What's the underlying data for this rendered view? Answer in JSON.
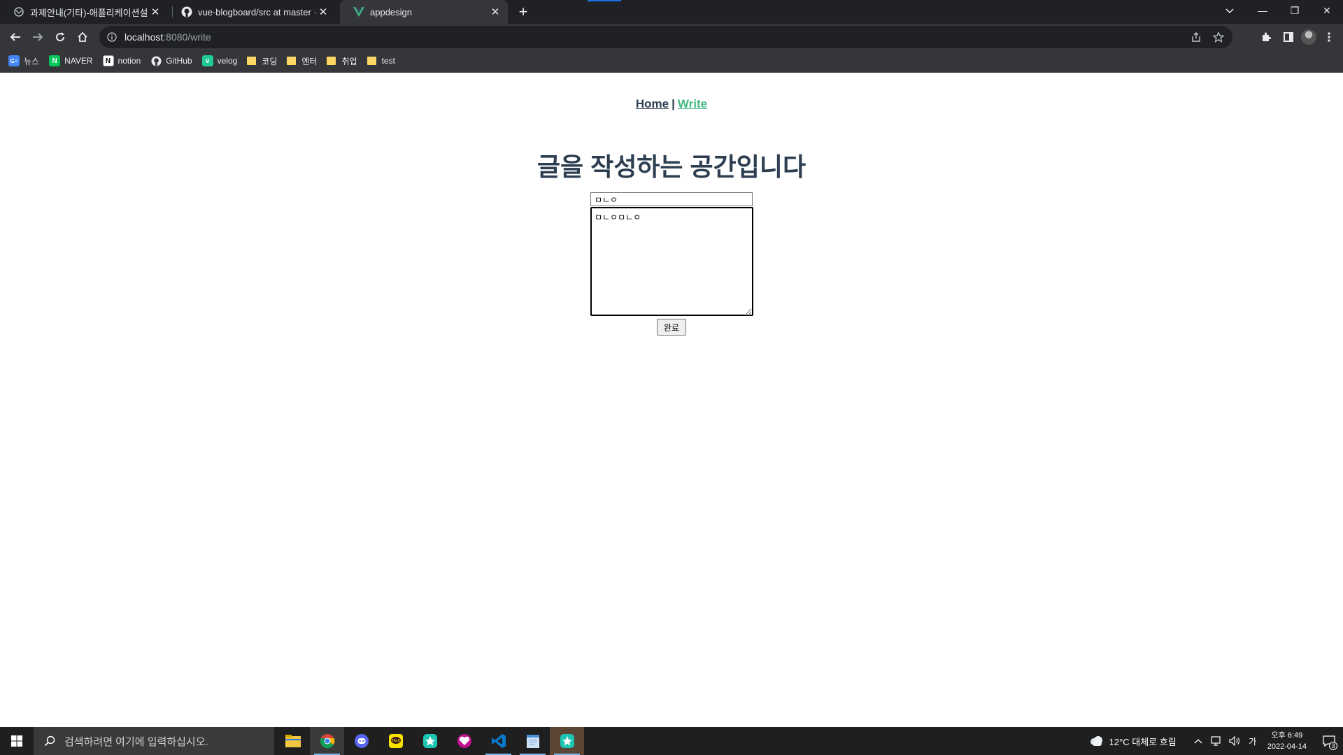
{
  "browser": {
    "tabs": [
      {
        "title": "과제안내(기타)-애플리케이션설계",
        "icon": "generic-globe-icon",
        "active": false
      },
      {
        "title": "vue-blogboard/src at master · h",
        "icon": "github-icon",
        "active": false
      },
      {
        "title": "appdesign",
        "icon": "vue-icon",
        "active": true
      }
    ],
    "url_host": "localhost",
    "url_path": ":8080/write",
    "bookmarks": [
      {
        "label": "뉴스",
        "icon": "google-news-icon"
      },
      {
        "label": "NAVER",
        "icon": "naver-icon"
      },
      {
        "label": "notion",
        "icon": "notion-icon"
      },
      {
        "label": "GitHub",
        "icon": "github-icon"
      },
      {
        "label": "velog",
        "icon": "velog-icon"
      },
      {
        "label": "코딩",
        "icon": "folder-icon"
      },
      {
        "label": "엔터",
        "icon": "folder-icon"
      },
      {
        "label": "취업",
        "icon": "folder-icon"
      },
      {
        "label": "test",
        "icon": "folder-icon"
      }
    ]
  },
  "page": {
    "nav": {
      "home": "Home",
      "separator": "|",
      "write": "Write"
    },
    "heading": "글을 작성하는 공간입니다",
    "title_value": "ㅁㄴㅇ",
    "content_value": "ㅁㄴㅇㅁㄴㅇ",
    "submit_label": "완료"
  },
  "taskbar": {
    "search_placeholder": "검색하려면 여기에 입력하십시오.",
    "weather": "12°C  대체로 흐림",
    "ime": "가",
    "time": "오후 6:49",
    "date": "2022-04-14",
    "notification_count": "3"
  },
  "colors": {
    "accent_green": "#42b983",
    "text_dark": "#2c3e50"
  }
}
